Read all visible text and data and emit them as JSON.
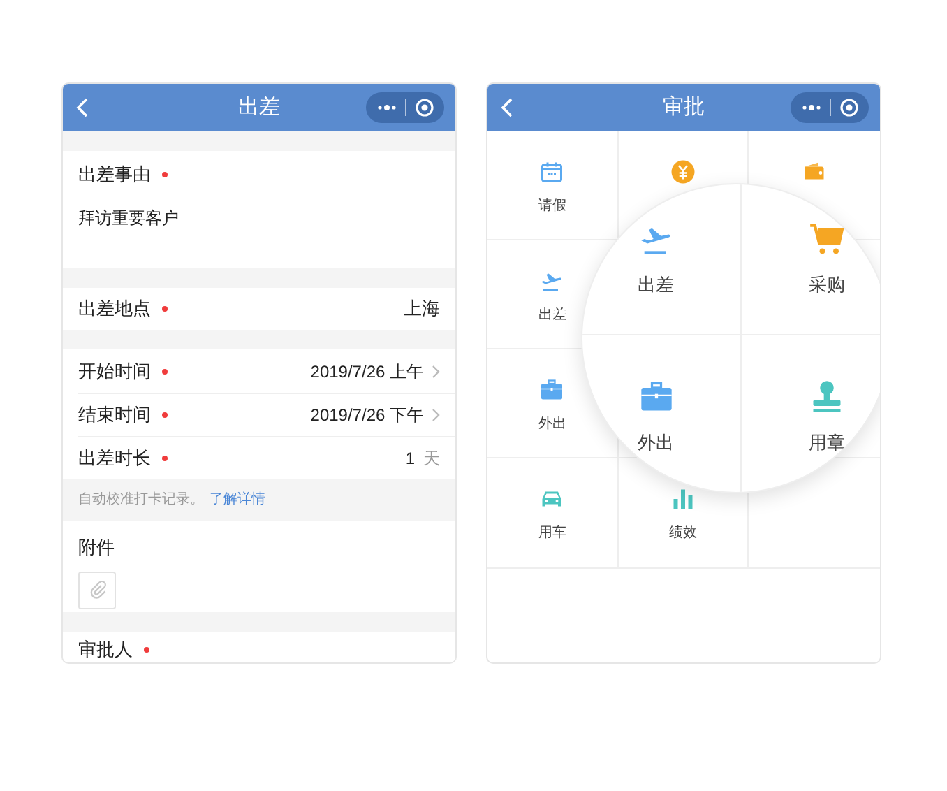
{
  "left": {
    "header": {
      "title": "出差"
    },
    "reason": {
      "label": "出差事由",
      "required": true,
      "value": "拜访重要客户"
    },
    "location": {
      "label": "出差地点",
      "required": true,
      "value": "上海"
    },
    "fields": [
      {
        "kind": "date",
        "label": "开始时间",
        "required": true,
        "value": "2019/7/26 上午"
      },
      {
        "kind": "date",
        "label": "结束时间",
        "required": true,
        "value": "2019/7/26 下午"
      },
      {
        "kind": "number",
        "label": "出差时长",
        "required": true,
        "value": "1",
        "unit": "天"
      }
    ],
    "hint": {
      "text": "自动校准打卡记录。",
      "link": "了解详情"
    },
    "attachments": {
      "label": "附件"
    },
    "approver": {
      "label": "审批人",
      "required": true
    }
  },
  "right": {
    "header": {
      "title": "审批"
    },
    "grid": [
      {
        "kind": "calendar",
        "label": "请假"
      },
      {
        "kind": "coin"
      },
      {
        "kind": "wallet"
      },
      {
        "kind": "plane",
        "label": "出差"
      },
      {
        "kind": "empty"
      },
      {
        "kind": "empty"
      },
      {
        "kind": "briefcase",
        "label": "外出"
      },
      {
        "kind": "empty"
      },
      {
        "kind": "empty"
      },
      {
        "kind": "car",
        "label": "用车"
      },
      {
        "kind": "chart",
        "label": "绩效"
      },
      {
        "kind": "empty"
      }
    ],
    "magnifier": {
      "items": [
        {
          "kind": "plane",
          "label": "出差"
        },
        {
          "kind": "cart",
          "label": "采购"
        },
        {
          "kind": "briefcase",
          "label": "外出"
        },
        {
          "kind": "stamp",
          "label": "用章"
        }
      ]
    }
  }
}
